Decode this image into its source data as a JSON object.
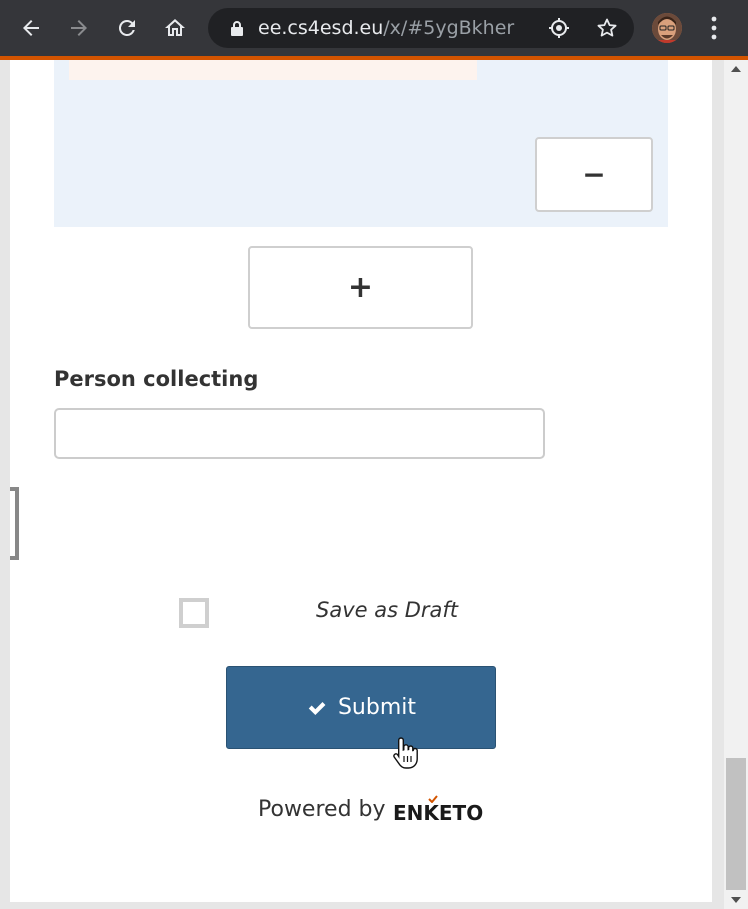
{
  "browser": {
    "url_host": "ee.cs4esd.eu",
    "url_path": "/x/#5ygBkher",
    "icons": {
      "back": "back-arrow-icon",
      "forward": "forward-arrow-icon",
      "reload": "reload-icon",
      "home": "home-icon",
      "lock": "lock-icon",
      "location": "location-target-icon",
      "bookmark": "star-icon",
      "menu": "kebab-menu-icon"
    },
    "colors": {
      "toolbar": "#35363a",
      "omnibox": "#202124",
      "accent_strip": "#d35400"
    }
  },
  "form": {
    "repeat": {
      "remove_label": "−",
      "add_label": "+"
    },
    "person_collecting": {
      "label": "Person collecting",
      "value": "",
      "placeholder": ""
    },
    "save_draft": {
      "label": "Save as Draft",
      "checked": false
    },
    "submit": {
      "label": "Submit",
      "icon": "check-icon",
      "color": "#356690"
    },
    "footer": {
      "powered_by": "Powered by",
      "brand": "ENKETO",
      "brand_accent": "#d35400"
    }
  }
}
